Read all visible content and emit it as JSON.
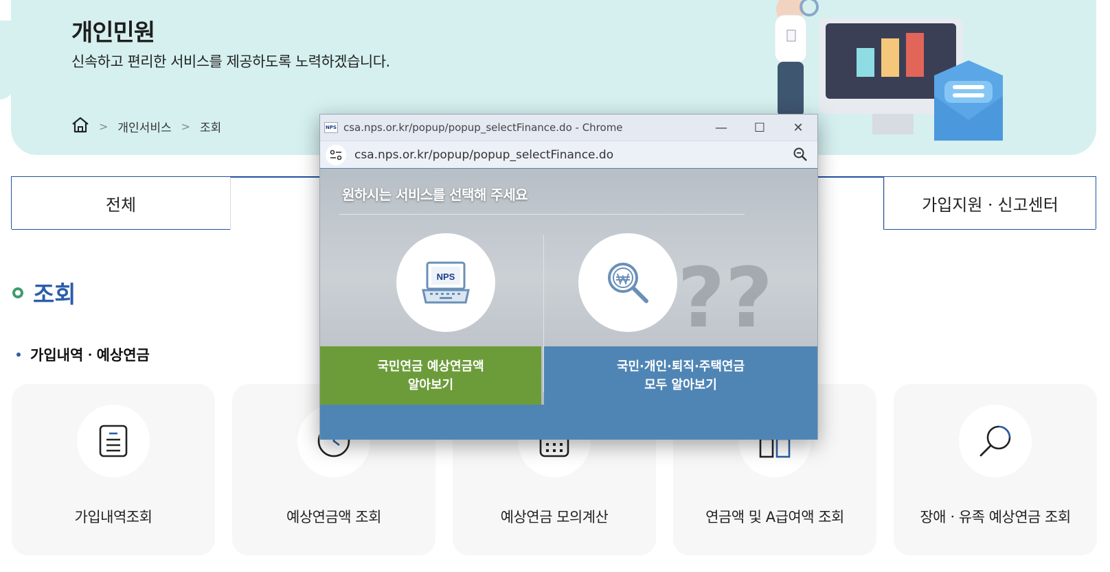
{
  "hero": {
    "title": "개인민원",
    "subtitle": "신속하고 편리한 서비스를 제공하도록 노력하겠습니다.",
    "breadcrumb": {
      "home_icon": "home-icon",
      "items": [
        "개인서비스",
        "조회"
      ],
      "separator": ">"
    }
  },
  "tabs": [
    {
      "label": "전체",
      "active": false
    },
    {
      "label": "",
      "active": true
    },
    {
      "label": "가입지원ㆍ신고센터",
      "active": false
    }
  ],
  "section": {
    "title": "조회",
    "subtitle": "가입내역ㆍ예상연금"
  },
  "cards": [
    {
      "label": "가입내역조회",
      "icon": "document-icon"
    },
    {
      "label": "예상연금액 조회",
      "icon": "clock-icon"
    },
    {
      "label": "예상연금 모의계산",
      "icon": "calculator-icon"
    },
    {
      "label": "연금액 및 A급여액 조회",
      "icon": "columns-icon"
    },
    {
      "label": "장애ㆍ유족 예상연금 조회",
      "icon": "search-icon"
    }
  ],
  "popup": {
    "window_title": "csa.nps.or.kr/popup/popup_selectFinance.do - Chrome",
    "favicon_text": "NPS",
    "address": "csa.nps.or.kr/popup/popup_selectFinance.do",
    "heading": "원하시는 서비스를 선택해 주세요",
    "options": [
      {
        "line1": "국민연금 예상연금액",
        "line2": "알아보기",
        "icon": "laptop-icon",
        "laptop_text": "NPS",
        "color": "#6c9c3a"
      },
      {
        "line1": "국민·개인·퇴직·주택연금",
        "line2": "모두 알아보기",
        "icon": "won-magnifier-icon",
        "color": "#4f85b5"
      }
    ]
  },
  "colors": {
    "hero_bg": "#d5f0ef",
    "tab_border": "#1f4fa0",
    "section_title": "#2b5ea8",
    "popup_blue": "#4f85b5",
    "popup_green": "#6c9c3a"
  }
}
